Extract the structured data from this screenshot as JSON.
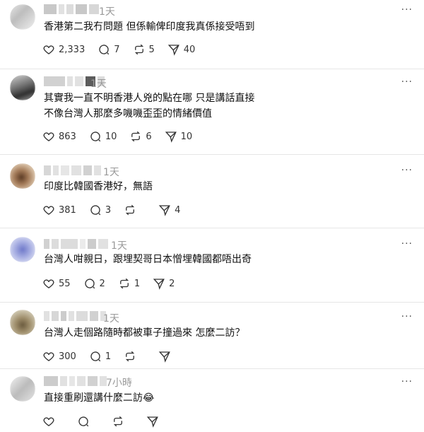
{
  "posts": [
    {
      "time": "1天",
      "text": "香港第二我冇問題 但係輸俾印度我真係接受唔到",
      "likes": "2,333",
      "replies": "7",
      "reposts": "5",
      "shares": "40"
    },
    {
      "time": "1天",
      "text": "其實我一直不明香港人兇的點在哪 只是講話直接\n不像台灣人那麼多嘰嘰歪歪的情緒價值",
      "likes": "863",
      "replies": "10",
      "reposts": "6",
      "shares": "10"
    },
    {
      "time": "1天",
      "text": "印度比韓國香港好，無語",
      "likes": "381",
      "replies": "3",
      "reposts": "",
      "shares": "4"
    },
    {
      "time": "1天",
      "text": "台灣人咁親日，跟埋契哥日本憎埋韓國都唔出奇",
      "likes": "55",
      "replies": "2",
      "reposts": "1",
      "shares": "2"
    },
    {
      "time": "1天",
      "text": "台灣人走個路隨時都被車子撞過來 怎麼二訪？",
      "likes": "300",
      "replies": "1",
      "reposts": "",
      "shares": ""
    },
    {
      "time": "7小時",
      "text": "直接重刷還講什麼二訪😂",
      "likes": "",
      "replies": "",
      "reposts": "",
      "shares": ""
    }
  ],
  "more_label": "···",
  "icons": {
    "like": "heart-icon",
    "reply": "comment-icon",
    "repost": "repost-icon",
    "share": "send-icon",
    "more": "more-options-icon"
  },
  "colors": {
    "text": "#101010",
    "muted": "#9a9a9a",
    "divider": "#e6e6e6"
  }
}
